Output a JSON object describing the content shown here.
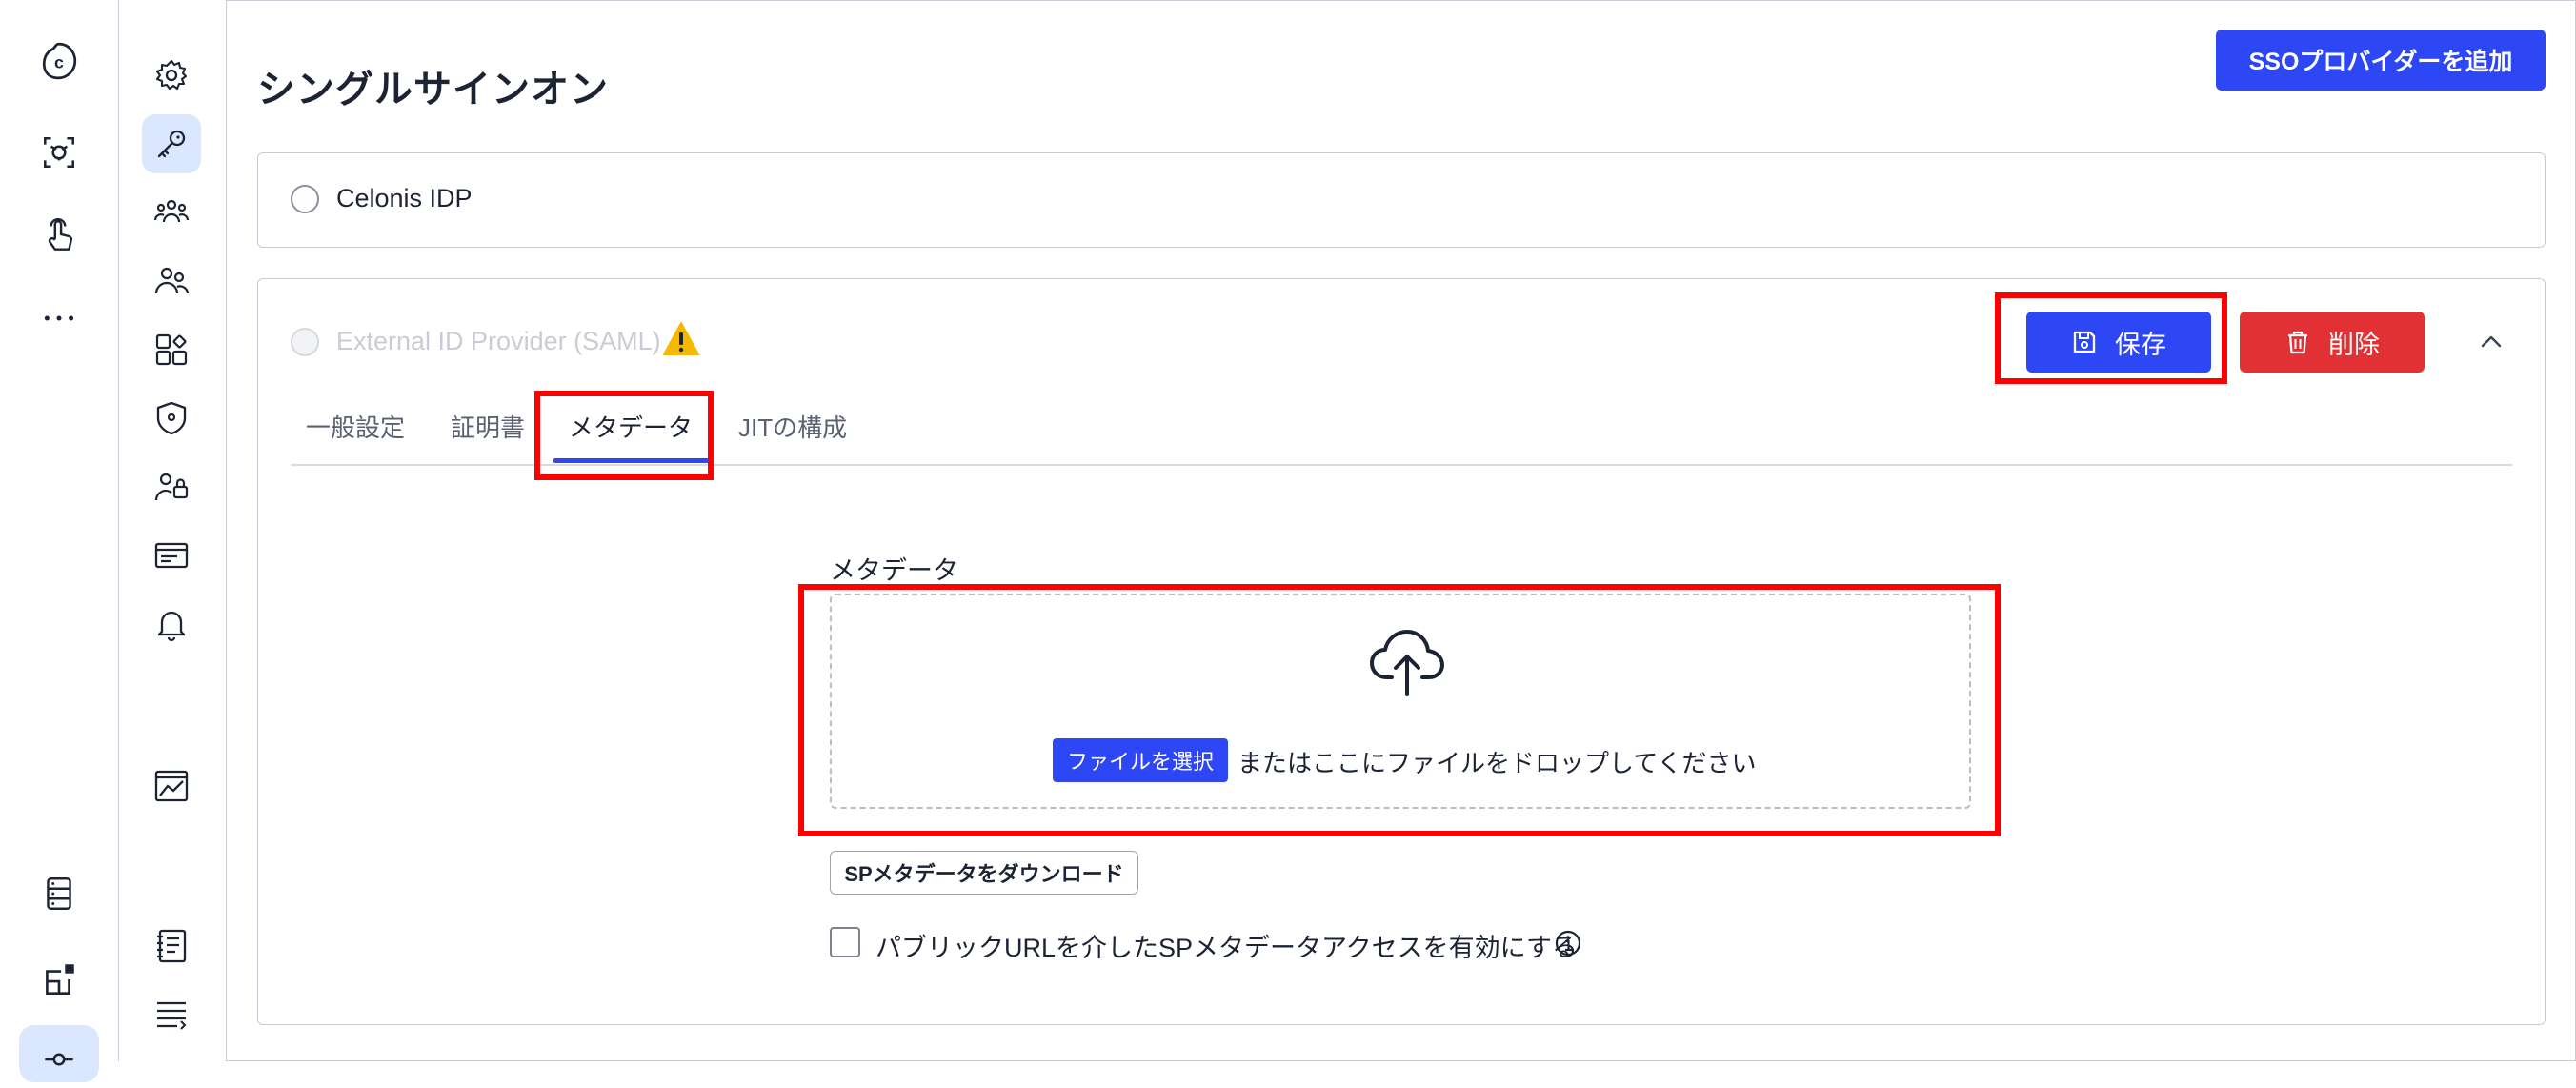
{
  "page": {
    "title": "シングルサインオン",
    "add_sso_label": "SSOプロバイダーを追加"
  },
  "providers": {
    "celonis": {
      "label": "Celonis IDP"
    },
    "external": {
      "label": "External ID Provider (SAML)",
      "save_label": "保存",
      "delete_label": "削除"
    }
  },
  "tabs": [
    {
      "label": "一般設定"
    },
    {
      "label": "証明書"
    },
    {
      "label": "メタデータ"
    },
    {
      "label": "JITの構成"
    }
  ],
  "active_tab": "メタデータ",
  "metadata": {
    "field_label": "メタデータ",
    "choose_file_label": "ファイルを選択",
    "drop_text": "またはここにファイルをドロップしてください",
    "download_label": "SPメタデータをダウンロード",
    "public_url_label": "パブリックURLを介したSPメタデータアクセスを有効にする",
    "public_url_checked": false
  },
  "colors": {
    "primary": "#2d47f5",
    "danger": "#e23134",
    "warning": "#f5b800",
    "highlight": "#ff0000",
    "active_nav_bg": "#dbe6ff"
  },
  "rail1_icons": [
    "celonis-logo-icon",
    "process-scan-icon",
    "touch-pointer-icon",
    "more-dots-icon",
    "database-icon",
    "app-marketplace-icon",
    "settings-sliders-icon"
  ],
  "rail2_icons": [
    "gear-icon",
    "key-icon",
    "team-icon",
    "users-icon",
    "apps-icon",
    "shield-icon",
    "user-lock-icon",
    "card-icon",
    "bell-icon",
    "chart-icon",
    "notebook-icon",
    "list-icon"
  ]
}
